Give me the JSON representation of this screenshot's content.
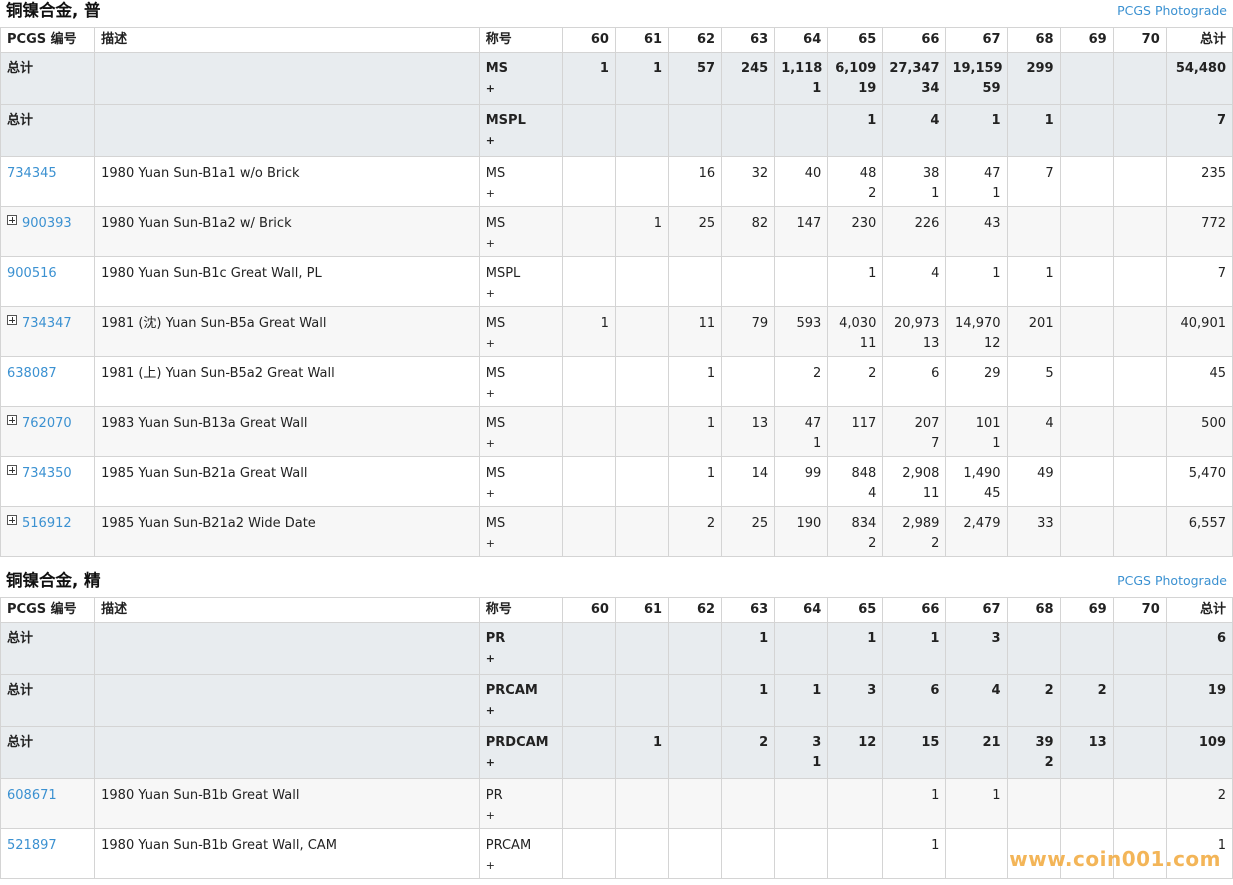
{
  "header_cols": {
    "pcgs": "PCGS 编号",
    "desc": "描述",
    "desig": "称号",
    "grades": [
      "60",
      "61",
      "62",
      "63",
      "64",
      "65",
      "66",
      "67",
      "68",
      "69",
      "70"
    ],
    "total": "总计"
  },
  "sections": [
    {
      "title": "铜镍合金, 普",
      "link": "PCGS Photograde",
      "rows": [
        {
          "kind": "total",
          "pcgs": "总计",
          "desc": "",
          "desig": "MS",
          "plus": "+",
          "grades": [
            [
              "1",
              ""
            ],
            [
              "1",
              ""
            ],
            [
              "57",
              ""
            ],
            [
              "245",
              ""
            ],
            [
              "1,118",
              "1"
            ],
            [
              "6,109",
              "19"
            ],
            [
              "27,347",
              "34"
            ],
            [
              "19,159",
              "59"
            ],
            [
              "299",
              ""
            ],
            [
              "",
              ""
            ],
            [
              "",
              ""
            ]
          ],
          "total": "54,480"
        },
        {
          "kind": "total",
          "pcgs": "总计",
          "desc": "",
          "desig": "MSPL",
          "plus": "+",
          "grades": [
            [
              "",
              ""
            ],
            [
              "",
              ""
            ],
            [
              "",
              ""
            ],
            [
              "",
              ""
            ],
            [
              "",
              ""
            ],
            [
              "1",
              ""
            ],
            [
              "4",
              ""
            ],
            [
              "1",
              ""
            ],
            [
              "1",
              ""
            ],
            [
              "",
              ""
            ],
            [
              "",
              ""
            ]
          ],
          "total": "7"
        },
        {
          "kind": "item",
          "pcgs": "734345",
          "expand": false,
          "desc": "1980 Yuan Sun-B1a1 w/o Brick",
          "desig": "MS",
          "plus": "+",
          "grades": [
            [
              "",
              ""
            ],
            [
              "",
              ""
            ],
            [
              "16",
              ""
            ],
            [
              "32",
              ""
            ],
            [
              "40",
              ""
            ],
            [
              "48",
              "2"
            ],
            [
              "38",
              "1"
            ],
            [
              "47",
              "1"
            ],
            [
              "7",
              ""
            ],
            [
              "",
              ""
            ],
            [
              "",
              ""
            ]
          ],
          "total": "235"
        },
        {
          "kind": "item",
          "pcgs": "900393",
          "expand": true,
          "desc": "1980 Yuan Sun-B1a2 w/ Brick",
          "desig": "MS",
          "plus": "+",
          "grades": [
            [
              "",
              ""
            ],
            [
              "1",
              ""
            ],
            [
              "25",
              ""
            ],
            [
              "82",
              ""
            ],
            [
              "147",
              ""
            ],
            [
              "230",
              ""
            ],
            [
              "226",
              ""
            ],
            [
              "43",
              ""
            ],
            [
              "",
              ""
            ],
            [
              "",
              ""
            ],
            [
              "",
              ""
            ]
          ],
          "total": "772"
        },
        {
          "kind": "item",
          "pcgs": "900516",
          "expand": false,
          "desc": "1980 Yuan Sun-B1c Great Wall, PL",
          "desig": "MSPL",
          "plus": "+",
          "grades": [
            [
              "",
              ""
            ],
            [
              "",
              ""
            ],
            [
              "",
              ""
            ],
            [
              "",
              ""
            ],
            [
              "",
              ""
            ],
            [
              "1",
              ""
            ],
            [
              "4",
              ""
            ],
            [
              "1",
              ""
            ],
            [
              "1",
              ""
            ],
            [
              "",
              ""
            ],
            [
              "",
              ""
            ]
          ],
          "total": "7"
        },
        {
          "kind": "item",
          "pcgs": "734347",
          "expand": true,
          "desc": "1981 (沈) Yuan Sun-B5a Great Wall",
          "desig": "MS",
          "plus": "+",
          "grades": [
            [
              "1",
              ""
            ],
            [
              "",
              ""
            ],
            [
              "11",
              ""
            ],
            [
              "79",
              ""
            ],
            [
              "593",
              ""
            ],
            [
              "4,030",
              "11"
            ],
            [
              "20,973",
              "13"
            ],
            [
              "14,970",
              "12"
            ],
            [
              "201",
              ""
            ],
            [
              "",
              ""
            ],
            [
              "",
              ""
            ]
          ],
          "total": "40,901"
        },
        {
          "kind": "item",
          "pcgs": "638087",
          "expand": false,
          "desc": "1981 (上) Yuan Sun-B5a2 Great Wall",
          "desig": "MS",
          "plus": "+",
          "grades": [
            [
              "",
              ""
            ],
            [
              "",
              ""
            ],
            [
              "1",
              ""
            ],
            [
              "",
              ""
            ],
            [
              "2",
              ""
            ],
            [
              "2",
              ""
            ],
            [
              "6",
              ""
            ],
            [
              "29",
              ""
            ],
            [
              "5",
              ""
            ],
            [
              "",
              ""
            ],
            [
              "",
              ""
            ]
          ],
          "total": "45"
        },
        {
          "kind": "item",
          "pcgs": "762070",
          "expand": true,
          "desc": "1983 Yuan Sun-B13a Great Wall",
          "desig": "MS",
          "plus": "+",
          "grades": [
            [
              "",
              ""
            ],
            [
              "",
              ""
            ],
            [
              "1",
              ""
            ],
            [
              "13",
              ""
            ],
            [
              "47",
              "1"
            ],
            [
              "117",
              ""
            ],
            [
              "207",
              "7"
            ],
            [
              "101",
              "1"
            ],
            [
              "4",
              ""
            ],
            [
              "",
              ""
            ],
            [
              "",
              ""
            ]
          ],
          "total": "500"
        },
        {
          "kind": "item",
          "pcgs": "734350",
          "expand": true,
          "desc": "1985 Yuan Sun-B21a Great Wall",
          "desig": "MS",
          "plus": "+",
          "grades": [
            [
              "",
              ""
            ],
            [
              "",
              ""
            ],
            [
              "1",
              ""
            ],
            [
              "14",
              ""
            ],
            [
              "99",
              ""
            ],
            [
              "848",
              "4"
            ],
            [
              "2,908",
              "11"
            ],
            [
              "1,490",
              "45"
            ],
            [
              "49",
              ""
            ],
            [
              "",
              ""
            ],
            [
              "",
              ""
            ]
          ],
          "total": "5,470"
        },
        {
          "kind": "item",
          "pcgs": "516912",
          "expand": true,
          "desc": "1985 Yuan Sun-B21a2 Wide Date",
          "desig": "MS",
          "plus": "+",
          "grades": [
            [
              "",
              ""
            ],
            [
              "",
              ""
            ],
            [
              "2",
              ""
            ],
            [
              "25",
              ""
            ],
            [
              "190",
              ""
            ],
            [
              "834",
              "2"
            ],
            [
              "2,989",
              "2"
            ],
            [
              "2,479",
              ""
            ],
            [
              "33",
              ""
            ],
            [
              "",
              ""
            ],
            [
              "",
              ""
            ]
          ],
          "total": "6,557"
        }
      ]
    },
    {
      "title": "铜镍合金, 精",
      "link": "PCGS Photograde",
      "rows": [
        {
          "kind": "total",
          "pcgs": "总计",
          "desc": "",
          "desig": "PR",
          "plus": "+",
          "grades": [
            [
              "",
              ""
            ],
            [
              "",
              ""
            ],
            [
              "",
              ""
            ],
            [
              "1",
              ""
            ],
            [
              "",
              ""
            ],
            [
              "1",
              ""
            ],
            [
              "1",
              ""
            ],
            [
              "3",
              ""
            ],
            [
              "",
              ""
            ],
            [
              "",
              ""
            ],
            [
              "",
              ""
            ]
          ],
          "total": "6"
        },
        {
          "kind": "total",
          "pcgs": "总计",
          "desc": "",
          "desig": "PRCAM",
          "plus": "+",
          "grades": [
            [
              "",
              ""
            ],
            [
              "",
              ""
            ],
            [
              "",
              ""
            ],
            [
              "1",
              ""
            ],
            [
              "1",
              ""
            ],
            [
              "3",
              ""
            ],
            [
              "6",
              ""
            ],
            [
              "4",
              ""
            ],
            [
              "2",
              ""
            ],
            [
              "2",
              ""
            ],
            [
              "",
              ""
            ]
          ],
          "total": "19"
        },
        {
          "kind": "total",
          "pcgs": "总计",
          "desc": "",
          "desig": "PRDCAM",
          "plus": "+",
          "grades": [
            [
              "",
              ""
            ],
            [
              "1",
              ""
            ],
            [
              "",
              ""
            ],
            [
              "2",
              ""
            ],
            [
              "3",
              "1"
            ],
            [
              "12",
              ""
            ],
            [
              "15",
              ""
            ],
            [
              "21",
              ""
            ],
            [
              "39",
              "2"
            ],
            [
              "13",
              ""
            ],
            [
              "",
              ""
            ]
          ],
          "total": "109"
        },
        {
          "kind": "item",
          "pcgs": "608671",
          "expand": false,
          "desc": "1980 Yuan Sun-B1b Great Wall",
          "desig": "PR",
          "plus": "+",
          "grades": [
            [
              "",
              ""
            ],
            [
              "",
              ""
            ],
            [
              "",
              ""
            ],
            [
              "",
              ""
            ],
            [
              "",
              ""
            ],
            [
              "",
              ""
            ],
            [
              "1",
              ""
            ],
            [
              "1",
              ""
            ],
            [
              "",
              ""
            ],
            [
              "",
              ""
            ],
            [
              "",
              ""
            ]
          ],
          "total": "2"
        },
        {
          "kind": "item",
          "pcgs": "521897",
          "expand": false,
          "desc": "1980 Yuan Sun-B1b Great Wall, CAM",
          "desig": "PRCAM",
          "plus": "+",
          "grades": [
            [
              "",
              ""
            ],
            [
              "",
              ""
            ],
            [
              "",
              ""
            ],
            [
              "",
              ""
            ],
            [
              "",
              ""
            ],
            [
              "",
              ""
            ],
            [
              "1",
              ""
            ],
            [
              "",
              ""
            ],
            [
              "",
              ""
            ],
            [
              "",
              ""
            ],
            [
              "",
              ""
            ]
          ],
          "total": "1"
        }
      ]
    }
  ],
  "watermark": "www.coin001.com"
}
